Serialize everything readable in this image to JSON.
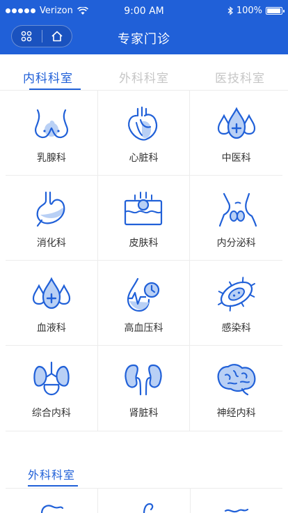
{
  "status_bar": {
    "carrier": "Verizon",
    "time": "9:00 AM",
    "battery": "100%"
  },
  "nav": {
    "title": "专家门诊"
  },
  "tabs": [
    {
      "label": "内科科室",
      "active": true
    },
    {
      "label": "外科科室",
      "active": false
    },
    {
      "label": "医技科室",
      "active": false
    }
  ],
  "departments": [
    {
      "label": "乳腺科",
      "icon": "breast-icon"
    },
    {
      "label": "心脏科",
      "icon": "heart-icon"
    },
    {
      "label": "中医科",
      "icon": "tcm-drops-icon"
    },
    {
      "label": "消化科",
      "icon": "stomach-icon"
    },
    {
      "label": "皮肤科",
      "icon": "skin-icon"
    },
    {
      "label": "内分泌科",
      "icon": "thyroid-icon"
    },
    {
      "label": "血液科",
      "icon": "blood-drops-icon"
    },
    {
      "label": "高血压科",
      "icon": "blood-pressure-icon"
    },
    {
      "label": "感染科",
      "icon": "virus-icon"
    },
    {
      "label": "综合内科",
      "icon": "organs-icon"
    },
    {
      "label": "肾脏科",
      "icon": "kidney-icon"
    },
    {
      "label": "神经内科",
      "icon": "brain-icon"
    }
  ],
  "section": {
    "title": "外科科室"
  },
  "colors": {
    "primary": "#2060d8",
    "icon_fill": "#b9d0f5"
  }
}
